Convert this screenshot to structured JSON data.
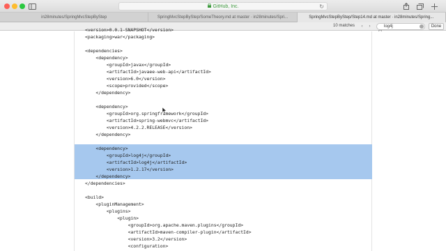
{
  "window": {
    "address": "GitHub, Inc.",
    "traffic_colors": [
      "#fd5f57",
      "#febc2e",
      "#2ac83f"
    ]
  },
  "tabs": [
    {
      "label": "in28minutes/SpringMvcStepByStep",
      "active": false
    },
    {
      "label": "SpringMvcStepByStep/SomeTheory.md at master · in28minutes/Spri...",
      "active": false
    },
    {
      "label": "SpringMvcStepByStep/Step14.md at master · in28minutes/Spring...",
      "active": true
    }
  ],
  "find": {
    "matches": "10 matches",
    "query": "log4j",
    "done_label": "Done"
  },
  "code_lines": [
    "<version>0.0.1-SNAPSHOT</version>",
    "<packaging>war</packaging>",
    "",
    "<dependencies>",
    "    <dependency>",
    "        <groupId>javax</groupId>",
    "        <artifactId>javaee-web-api</artifactId>",
    "        <version>6.0</version>",
    "        <scope>provided</scope>",
    "    </dependency>",
    "",
    "    <dependency>",
    "        <groupId>org.springframework</groupId>",
    "        <artifactId>spring-webmvc</artifactId>",
    "        <version>4.2.2.RELEASE</version>",
    "    </dependency>",
    "",
    "    <dependency>",
    "        <groupId>log4j</groupId>",
    "        <artifactId>log4j</artifactId>",
    "        <version>1.2.17</version>",
    "    </dependency>",
    "</dependencies>",
    "",
    "<build>",
    "    <pluginManagement>",
    "        <plugins>",
    "            <plugin>",
    "                <groupId>org.apache.maven.plugins</groupId>",
    "                <artifactId>maven-compiler-plugin</artifactId>",
    "                <version>3.2</version>",
    "                <configuration>",
    "                    <source>1.7</source>"
  ],
  "highlight_color": "#a6c8ee"
}
